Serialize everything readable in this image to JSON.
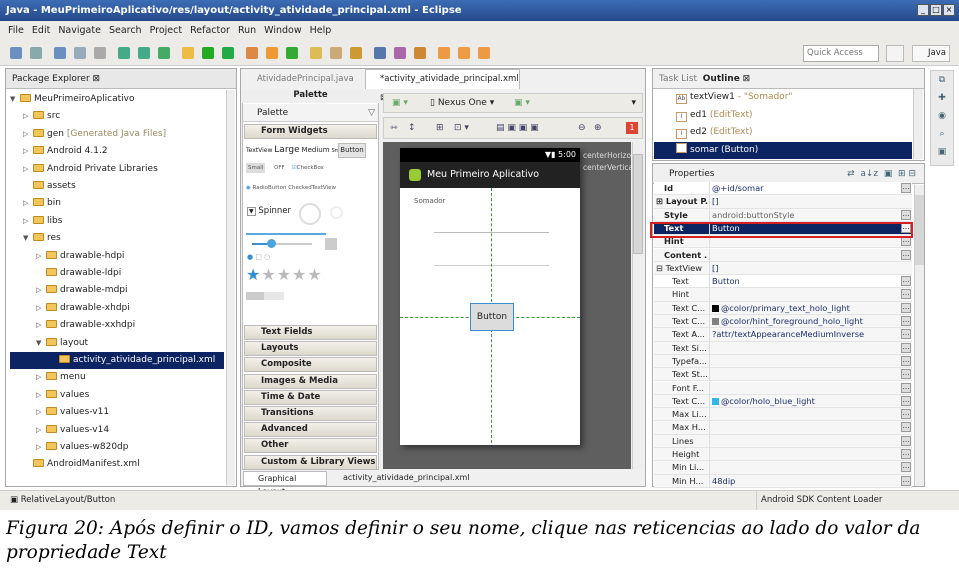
{
  "window": {
    "title": "Java - MeuPrimeiroAplicativo/res/layout/activity_atividade_principal.xml - Eclipse"
  },
  "menu": [
    "File",
    "Edit",
    "Navigate",
    "Search",
    "Project",
    "Refactor",
    "Run",
    "Window",
    "Help"
  ],
  "toolbar": {
    "quick_access_placeholder": "Quick Access",
    "perspective": "Java"
  },
  "package_explorer": {
    "tab": "Package Explorer",
    "items": [
      {
        "label": "MeuPrimeiroAplicativo",
        "depth": 0,
        "arrow": "open"
      },
      {
        "label": "src",
        "depth": 1,
        "arrow": "closed"
      },
      {
        "label": "gen",
        "note": "[Generated Java Files]",
        "depth": 1,
        "arrow": "closed"
      },
      {
        "label": "Android 4.1.2",
        "depth": 1,
        "arrow": "closed"
      },
      {
        "label": "Android Private Libraries",
        "depth": 1,
        "arrow": "closed"
      },
      {
        "label": "assets",
        "depth": 1,
        "arrow": ""
      },
      {
        "label": "bin",
        "depth": 1,
        "arrow": "closed"
      },
      {
        "label": "libs",
        "depth": 1,
        "arrow": "closed"
      },
      {
        "label": "res",
        "depth": 1,
        "arrow": "open"
      },
      {
        "label": "drawable-hdpi",
        "depth": 2,
        "arrow": "closed"
      },
      {
        "label": "drawable-ldpi",
        "depth": 2,
        "arrow": ""
      },
      {
        "label": "drawable-mdpi",
        "depth": 2,
        "arrow": "closed"
      },
      {
        "label": "drawable-xhdpi",
        "depth": 2,
        "arrow": "closed"
      },
      {
        "label": "drawable-xxhdpi",
        "depth": 2,
        "arrow": "closed"
      },
      {
        "label": "layout",
        "depth": 2,
        "arrow": "open"
      },
      {
        "label": "activity_atividade_principal.xml",
        "depth": 3,
        "arrow": "",
        "selected": true
      },
      {
        "label": "menu",
        "depth": 2,
        "arrow": "closed"
      },
      {
        "label": "values",
        "depth": 2,
        "arrow": "closed"
      },
      {
        "label": "values-v11",
        "depth": 2,
        "arrow": "closed"
      },
      {
        "label": "values-v14",
        "depth": 2,
        "arrow": "closed"
      },
      {
        "label": "values-w820dp",
        "depth": 2,
        "arrow": "closed"
      },
      {
        "label": "AndroidManifest.xml",
        "depth": 1,
        "arrow": ""
      }
    ]
  },
  "editor": {
    "tabs": [
      "AtividadePrincipal.java",
      "*activity_atividade_principal.xml"
    ],
    "bottom_tabs": [
      "Graphical Layout",
      "activity_atividade_principal.xml"
    ],
    "device": "Nexus One",
    "error_count": "1"
  },
  "palette": {
    "header": "Palette",
    "dropdown": "Palette",
    "open_category": "Form Widgets",
    "widgets_row1": [
      "TextView",
      "Large",
      "Medium",
      "Small",
      "Button"
    ],
    "widgets_row2": [
      "Small",
      "OFF",
      "CheckBox"
    ],
    "widgets_row3": "RadioButton CheckedTextView",
    "spinner": "Spinner",
    "categories": [
      "Text Fields",
      "Layouts",
      "Composite",
      "Images & Media",
      "Time & Date",
      "Transitions",
      "Advanced",
      "Other",
      "Custom & Library Views"
    ]
  },
  "device_preview": {
    "time": "5:00",
    "app_title": "Meu Primeiro Aplicativo",
    "label": "Somador",
    "button": "Button",
    "hints": [
      "centerHorizo",
      "centerVertica"
    ]
  },
  "outline": {
    "tabs": [
      "Task List",
      "Outline"
    ],
    "items": [
      {
        "name": "textView1",
        "detail": " - \"Somador\"",
        "icon": "Ab"
      },
      {
        "name": "ed1",
        "detail": " (EditText)",
        "icon": "I"
      },
      {
        "name": "ed2",
        "detail": " (EditText)",
        "icon": "I"
      },
      {
        "name": "somar (Button)",
        "detail": "",
        "icon": "btn",
        "selected": true
      }
    ]
  },
  "properties": {
    "title": "Properties",
    "rows": [
      {
        "k": "Id",
        "v": "@+id/somar",
        "bold": true
      },
      {
        "k": "Layout P...",
        "v": "[]",
        "bold": true,
        "expand": "+"
      },
      {
        "k": "Style",
        "v": "android:buttonStyle",
        "bold": true
      },
      {
        "k": "Text",
        "v": "Button",
        "bold": true,
        "selected": true
      },
      {
        "k": "Hint",
        "v": "",
        "bold": true
      },
      {
        "k": "Content ...",
        "v": "",
        "bold": true
      },
      {
        "k": "TextView",
        "v": "[]",
        "expand": "-"
      },
      {
        "k": "Text",
        "v": "Button",
        "sub": true
      },
      {
        "k": "Hint",
        "v": "",
        "sub": true
      },
      {
        "k": "Text C...",
        "v": "@color/primary_text_holo_light",
        "sub": true,
        "swatch": "#000000"
      },
      {
        "k": "Text C...",
        "v": "@color/hint_foreground_holo_light",
        "sub": true,
        "swatch": "#808080"
      },
      {
        "k": "Text A...",
        "v": "?attr/textAppearanceMediumInverse",
        "sub": true
      },
      {
        "k": "Text Si...",
        "v": "",
        "sub": true
      },
      {
        "k": "Typefa...",
        "v": "",
        "sub": true
      },
      {
        "k": "Text St...",
        "v": "",
        "sub": true
      },
      {
        "k": "Font F...",
        "v": "",
        "sub": true
      },
      {
        "k": "Text C...",
        "v": "@color/holo_blue_light",
        "sub": true,
        "swatch": "#33b5e5"
      },
      {
        "k": "Max Li...",
        "v": "",
        "sub": true
      },
      {
        "k": "Max H...",
        "v": "",
        "sub": true
      },
      {
        "k": "Lines",
        "v": "",
        "sub": true
      },
      {
        "k": "Height",
        "v": "",
        "sub": true
      },
      {
        "k": "Min Li...",
        "v": "",
        "sub": true
      },
      {
        "k": "Min H...",
        "v": "48dip",
        "sub": true
      }
    ]
  },
  "status": {
    "left": "RelativeLayout/Button",
    "right": "Android SDK Content Loader"
  },
  "caption": "Figura 20: Após definir o ID, vamos definir o seu nome, clique nas reticencias ao lado do valor da propriedade Text",
  "colors": {
    "selection": "#0c2461",
    "highlight_box": "#d62020",
    "title_bar": "#2a4f8a"
  }
}
